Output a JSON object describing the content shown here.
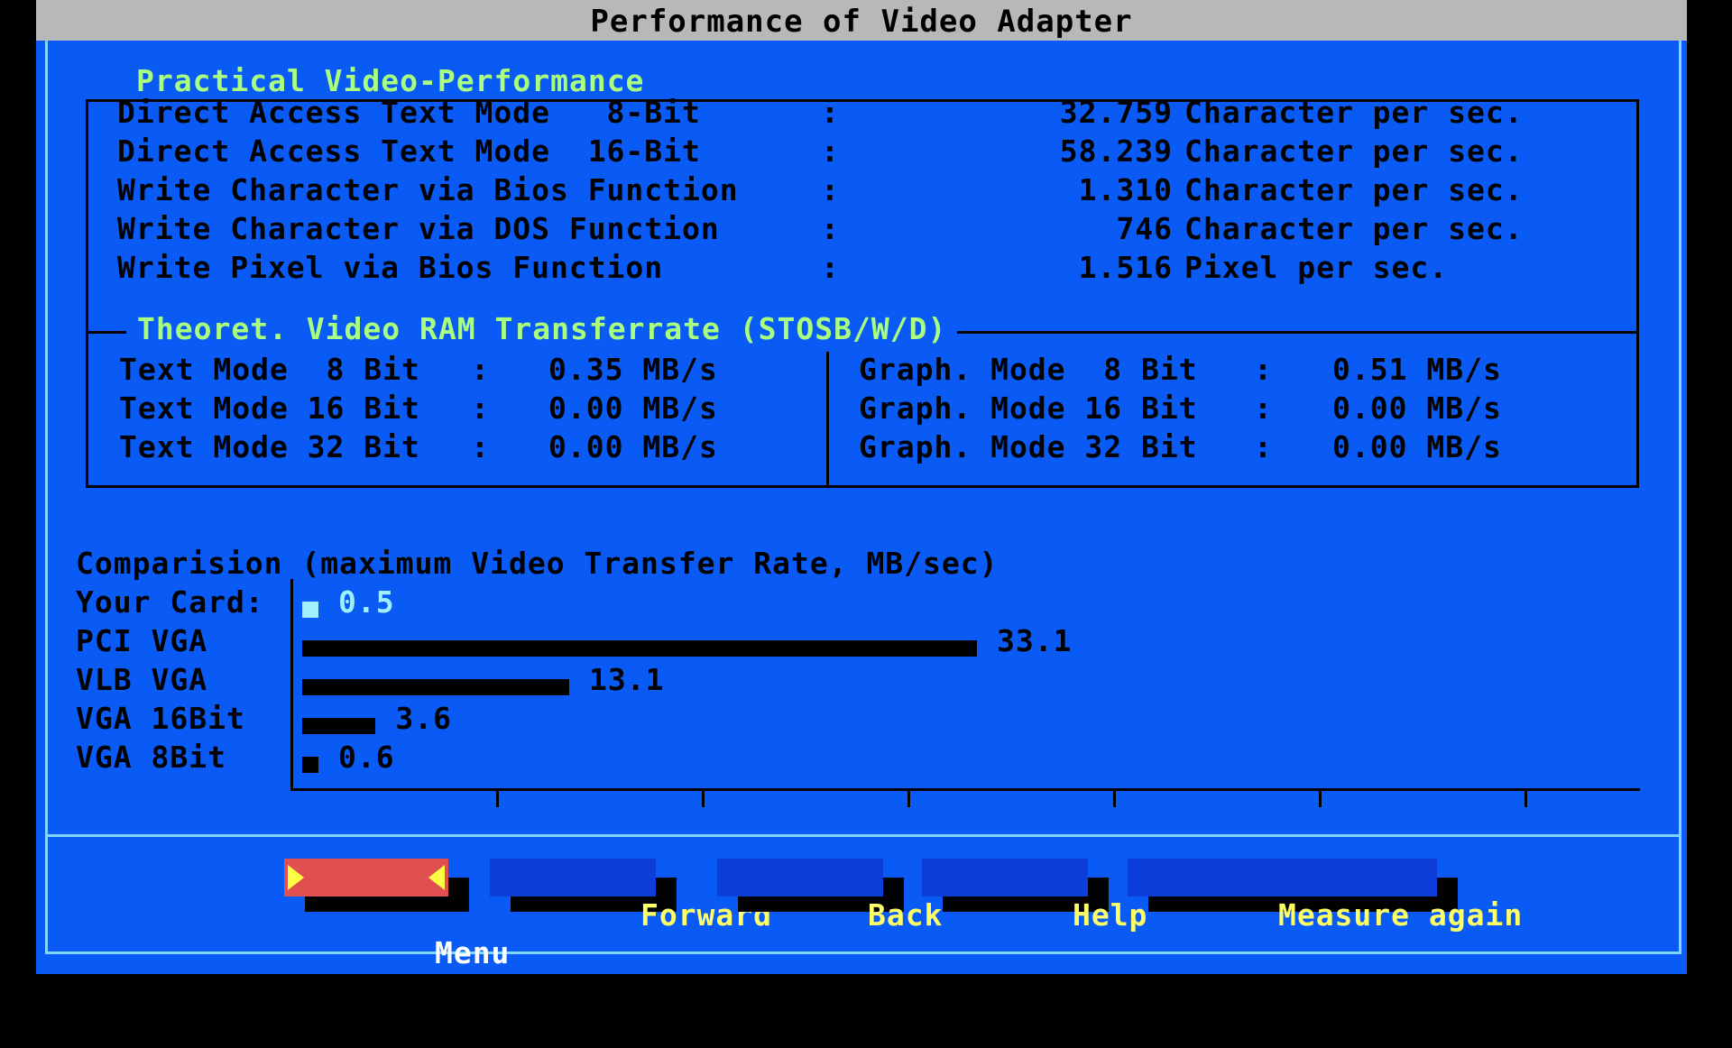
{
  "window": {
    "title": "Performance of Video Adapter"
  },
  "practical": {
    "title": "Practical Video-Performance",
    "rows": [
      {
        "label": "Direct Access Text Mode   8-Bit",
        "sep": ":",
        "value": "32.759",
        "unit": "Character per sec."
      },
      {
        "label": "Direct Access Text Mode  16-Bit",
        "sep": ":",
        "value": "58.239",
        "unit": "Character per sec."
      },
      {
        "label": "Write Character via Bios Function",
        "sep": ":",
        "value": "1.310",
        "unit": "Character per sec."
      },
      {
        "label": "Write Character via DOS Function",
        "sep": ":",
        "value": "746",
        "unit": "Character per sec."
      },
      {
        "label": "Write Pixel via Bios Function",
        "sep": ":",
        "value": "1.516",
        "unit": "Pixel per sec."
      }
    ]
  },
  "theoretical": {
    "title": "Theoret. Video RAM Transferrate (STOSB/W/D)",
    "text_modes": [
      {
        "label": "Text Mode  8 Bit",
        "sep": ":",
        "value": "0.35 MB/s"
      },
      {
        "label": "Text Mode 16 Bit",
        "sep": ":",
        "value": "0.00 MB/s"
      },
      {
        "label": "Text Mode 32 Bit",
        "sep": ":",
        "value": "0.00 MB/s"
      }
    ],
    "graph_modes": [
      {
        "label": "Graph. Mode  8 Bit",
        "sep": ":",
        "value": "0.51 MB/s"
      },
      {
        "label": "Graph. Mode 16 Bit",
        "sep": ":",
        "value": "0.00 MB/s"
      },
      {
        "label": "Graph. Mode 32 Bit",
        "sep": ":",
        "value": "0.00 MB/s"
      }
    ]
  },
  "comparison": {
    "title": "Comparision (maximum Video Transfer Rate, MB/sec)"
  },
  "chart_data": {
    "type": "bar",
    "orientation": "horizontal",
    "title": "Comparision (maximum Video Transfer Rate, MB/sec)",
    "categories": [
      "Your Card:",
      "PCI VGA",
      "VLB VGA",
      "VGA 16Bit",
      "VGA 8Bit"
    ],
    "values": [
      0.5,
      33.1,
      13.1,
      3.6,
      0.6
    ],
    "value_labels": [
      "0.5",
      "33.1",
      "13.1",
      "3.6",
      "0.6"
    ],
    "xlim": [
      0,
      66.2
    ],
    "ticks": 7,
    "grid": false,
    "colors": {
      "highlight": "#9fefff",
      "bars": "#000000"
    }
  },
  "buttons": [
    {
      "label": "Menu",
      "active": true
    },
    {
      "label": "Forward",
      "active": false
    },
    {
      "label": "Back",
      "active": false
    },
    {
      "label": "Help",
      "active": false
    },
    {
      "label": "Measure again",
      "active": false
    }
  ],
  "colors": {
    "background": "#0a5af5",
    "title_bar": "#b8b8b8",
    "section_title": "#aaff7f",
    "button_text": "#ffff66",
    "button_active": "#e05050",
    "frame_highlight": "#7fd6ff"
  }
}
